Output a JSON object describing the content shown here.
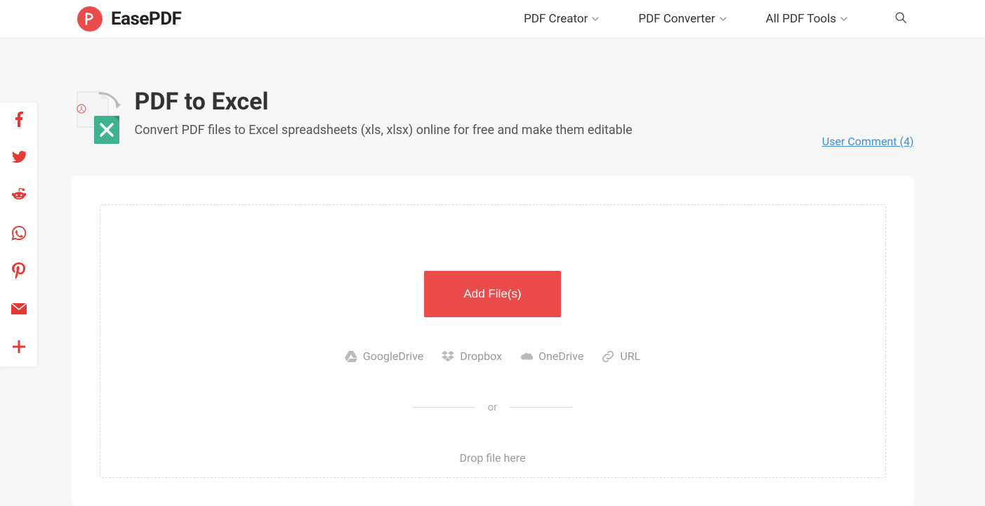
{
  "header": {
    "brand": "EasePDF",
    "nav": {
      "creator": "PDF Creator",
      "converter": "PDF Converter",
      "tools": "All PDF Tools"
    }
  },
  "page": {
    "title": "PDF to Excel",
    "subtitle": "Convert PDF files to Excel spreadsheets (xls, xlsx) online for free and make them editable",
    "user_comment_label": "User Comment (4)"
  },
  "upload": {
    "add_button": "Add File(s)",
    "sources": {
      "gdrive": "GoogleDrive",
      "dropbox": "Dropbox",
      "onedrive": "OneDrive",
      "url": "URL"
    },
    "or": "or",
    "drop_hint": "Drop file here"
  },
  "colors": {
    "accent": "#ea4c4c",
    "link": "#3a8ee6"
  }
}
